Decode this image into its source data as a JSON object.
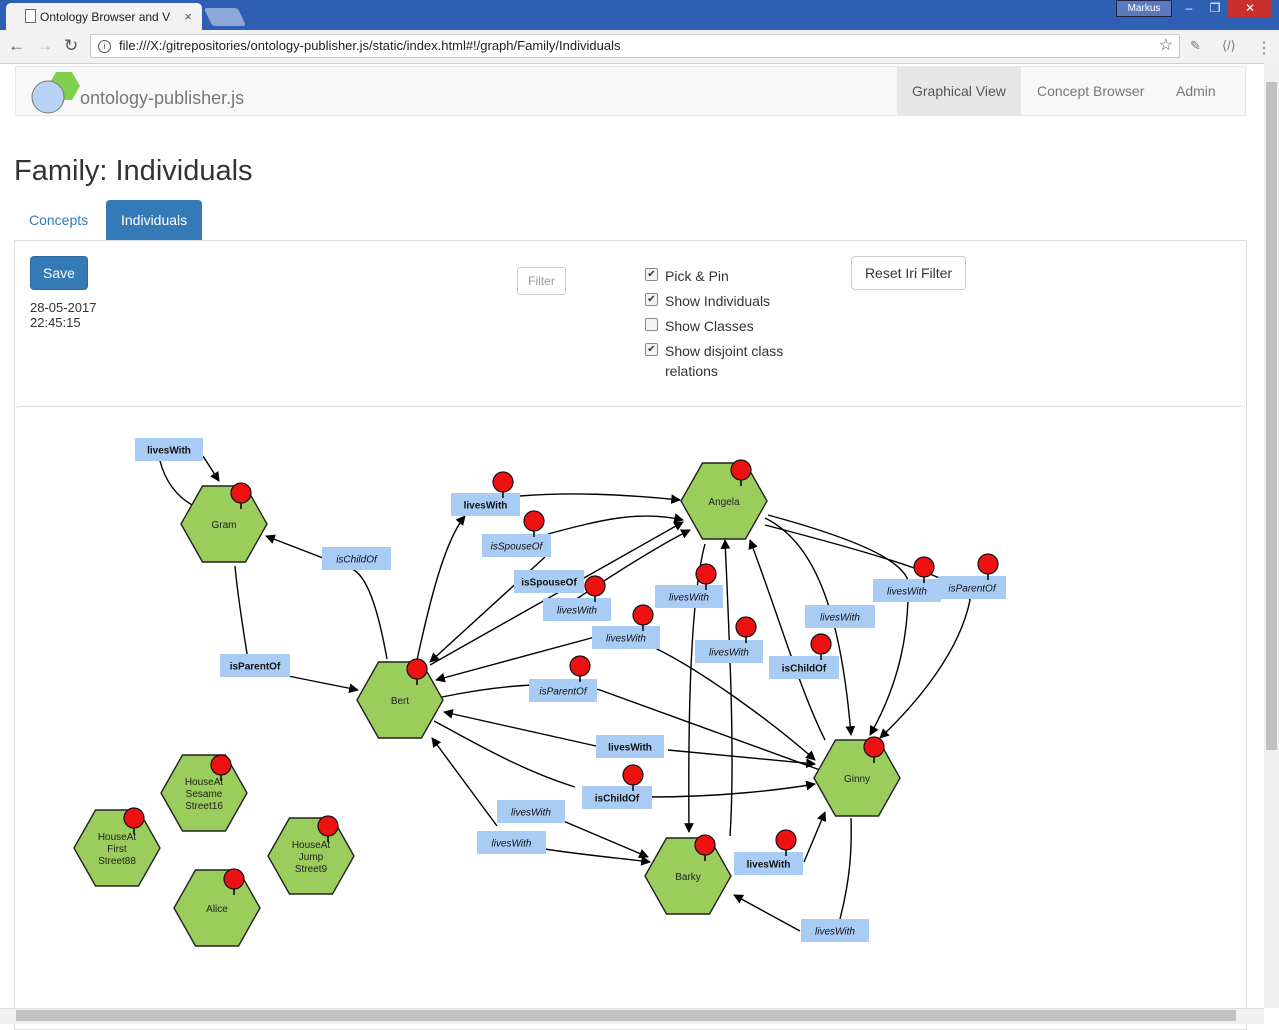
{
  "browser": {
    "tab_title": "Ontology Browser and V",
    "user": "Markus",
    "url": "file:///X:/gitrepositories/ontology-publisher.js/static/index.html#!/graph/Family/Individuals"
  },
  "app": {
    "brand": "ontology-publisher.js",
    "nav": [
      "Graphical View",
      "Concept Browser",
      "Admin"
    ]
  },
  "page": {
    "title": "Family: Individuals",
    "tabs": [
      "Concepts",
      "Individuals"
    ],
    "save": "Save",
    "timestamp": "28-05-2017 22:45:15",
    "filter_placeholder": "Filter",
    "options": {
      "pick_pin": "Pick & Pin",
      "show_individuals": "Show Individuals",
      "show_classes": "Show Classes",
      "show_disjoint": "Show disjoint class relations"
    },
    "reset": "Reset Iri Filter"
  },
  "graph": {
    "node_color": "#9acd5c",
    "pin_color": "#ee1111",
    "label_color": "#a9ccf5",
    "nodes": [
      {
        "id": "gram",
        "label": [
          "Gram"
        ]
      },
      {
        "id": "bert",
        "label": [
          "Bert"
        ]
      },
      {
        "id": "angela",
        "label": [
          "Angela"
        ]
      },
      {
        "id": "ginny",
        "label": [
          "Ginny"
        ]
      },
      {
        "id": "barky",
        "label": [
          "Barky"
        ]
      },
      {
        "id": "sesame",
        "label": [
          "HouseAt",
          "Sesame",
          "Street16"
        ]
      },
      {
        "id": "first",
        "label": [
          "HouseAt",
          "First",
          "Street88"
        ]
      },
      {
        "id": "jump",
        "label": [
          "HouseAt",
          "Jump",
          "Street9"
        ]
      },
      {
        "id": "alice",
        "label": [
          "Alice"
        ]
      }
    ],
    "edges": [
      {
        "text": "livesWith",
        "bold": true
      },
      {
        "text": "isChildOf",
        "bold": false
      },
      {
        "text": "isParentOf",
        "bold": true
      },
      {
        "text": "livesWith",
        "bold": true
      },
      {
        "text": "isSpouseOf",
        "bold": false
      },
      {
        "text": "isSpouseOf",
        "bold": true
      },
      {
        "text": "livesWith",
        "bold": false
      },
      {
        "text": "livesWith",
        "bold": false
      },
      {
        "text": "livesWith",
        "bold": false
      },
      {
        "text": "livesWith",
        "bold": false
      },
      {
        "text": "isParentOf",
        "bold": false
      },
      {
        "text": "isChildOf",
        "bold": true
      },
      {
        "text": "livesWith",
        "bold": false
      },
      {
        "text": "livesWith",
        "bold": false
      },
      {
        "text": "isParentOf",
        "bold": false
      },
      {
        "text": "livesWith",
        "bold": true
      },
      {
        "text": "isChildOf",
        "bold": true
      },
      {
        "text": "livesWith",
        "bold": false
      },
      {
        "text": "livesWith",
        "bold": false
      },
      {
        "text": "livesWith",
        "bold": true
      },
      {
        "text": "livesWith",
        "bold": false
      }
    ]
  }
}
